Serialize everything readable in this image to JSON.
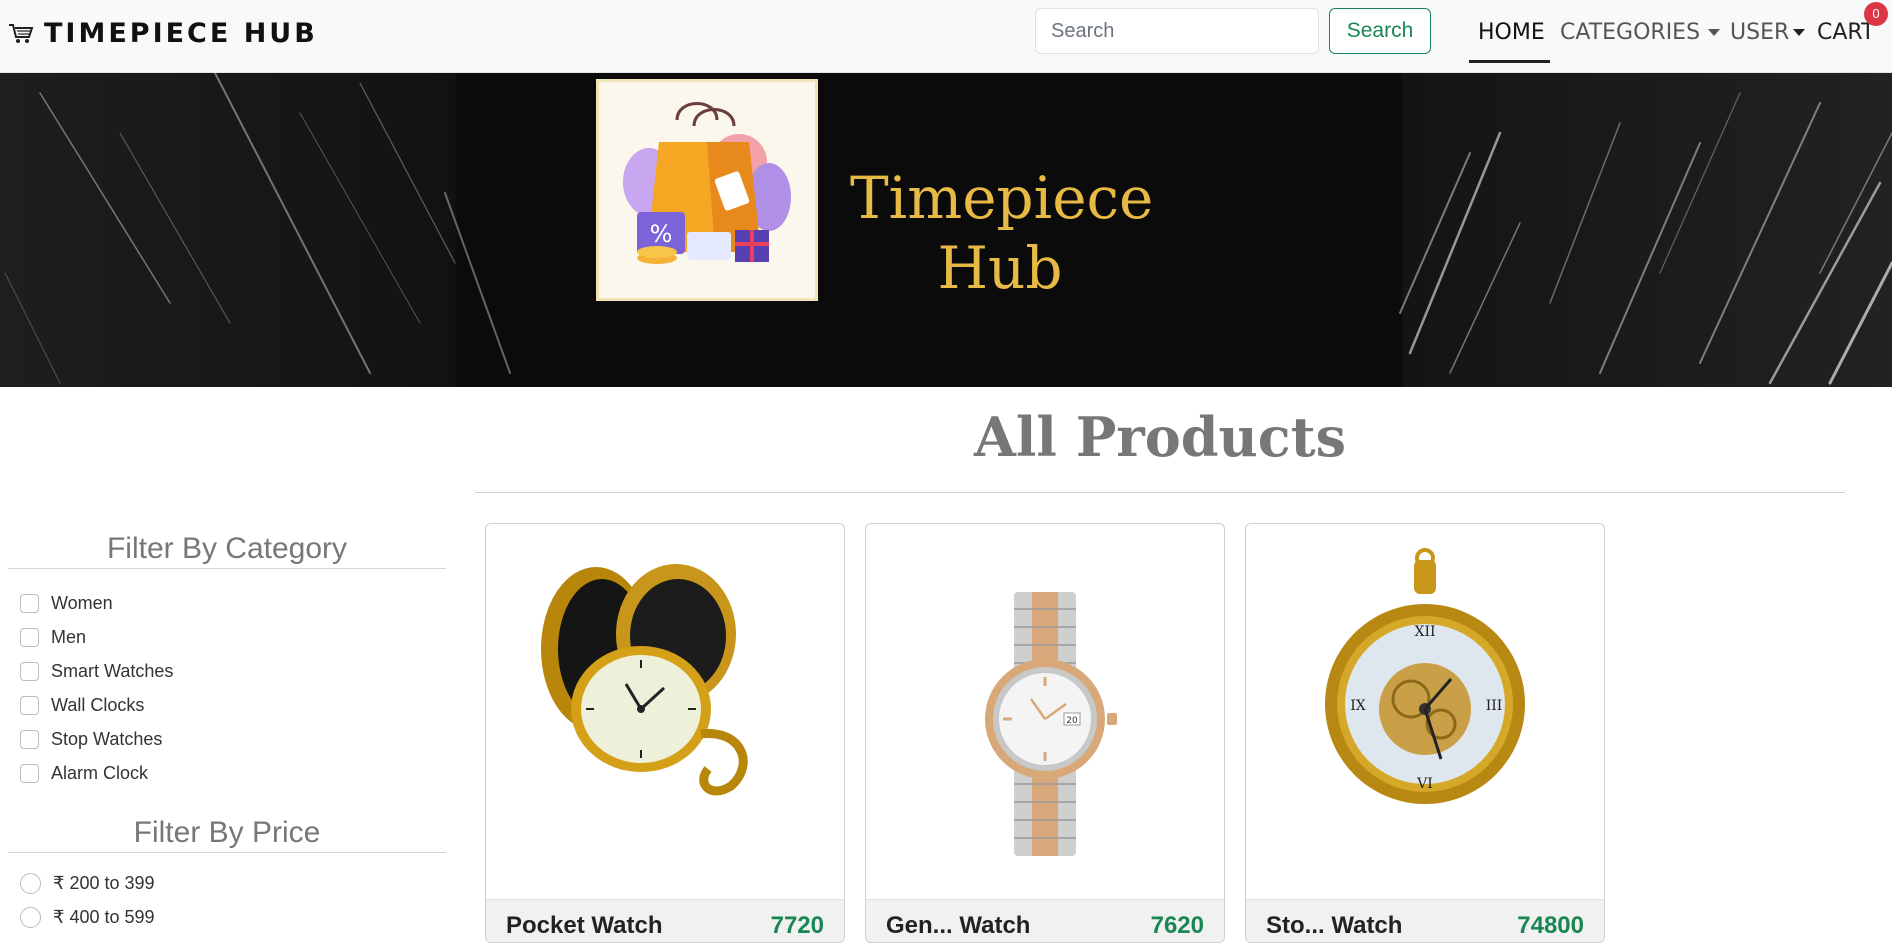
{
  "navbar": {
    "brand": "TIMEPIECE HUB",
    "brand_icon": "cart-icon",
    "search_placeholder": "Search",
    "search_button": "Search",
    "links": {
      "home": "HOME",
      "categories": "CATEGORIES",
      "user": "USER",
      "cart": "CART"
    },
    "cart_count": "0"
  },
  "banner": {
    "title_line1": "Timepiece",
    "title_line2": "Hub",
    "logo_icon": "shopping-bag-icon"
  },
  "main": {
    "title": "All Products"
  },
  "filters": {
    "category_heading": "Filter By Category",
    "categories": [
      "Women",
      "Men",
      "Smart Watches",
      "Wall Clocks",
      "Stop Watches",
      "Alarm Clock"
    ],
    "price_heading": "Filter By Price",
    "prices": [
      "₹ 200 to 399",
      "₹ 400 to 599"
    ]
  },
  "products": [
    {
      "name": "Pocket Watch",
      "price": "7720",
      "image_icon": "pocket-watch-icon"
    },
    {
      "name": "Gen... Watch",
      "price": "7620",
      "image_icon": "wrist-watch-icon"
    },
    {
      "name": "Sto... Watch",
      "price": "74800",
      "image_icon": "skeleton-pocket-watch-icon"
    }
  ],
  "colors": {
    "accent_green": "#198754",
    "badge_red": "#dc3545",
    "banner_gold": "#e7b945"
  }
}
